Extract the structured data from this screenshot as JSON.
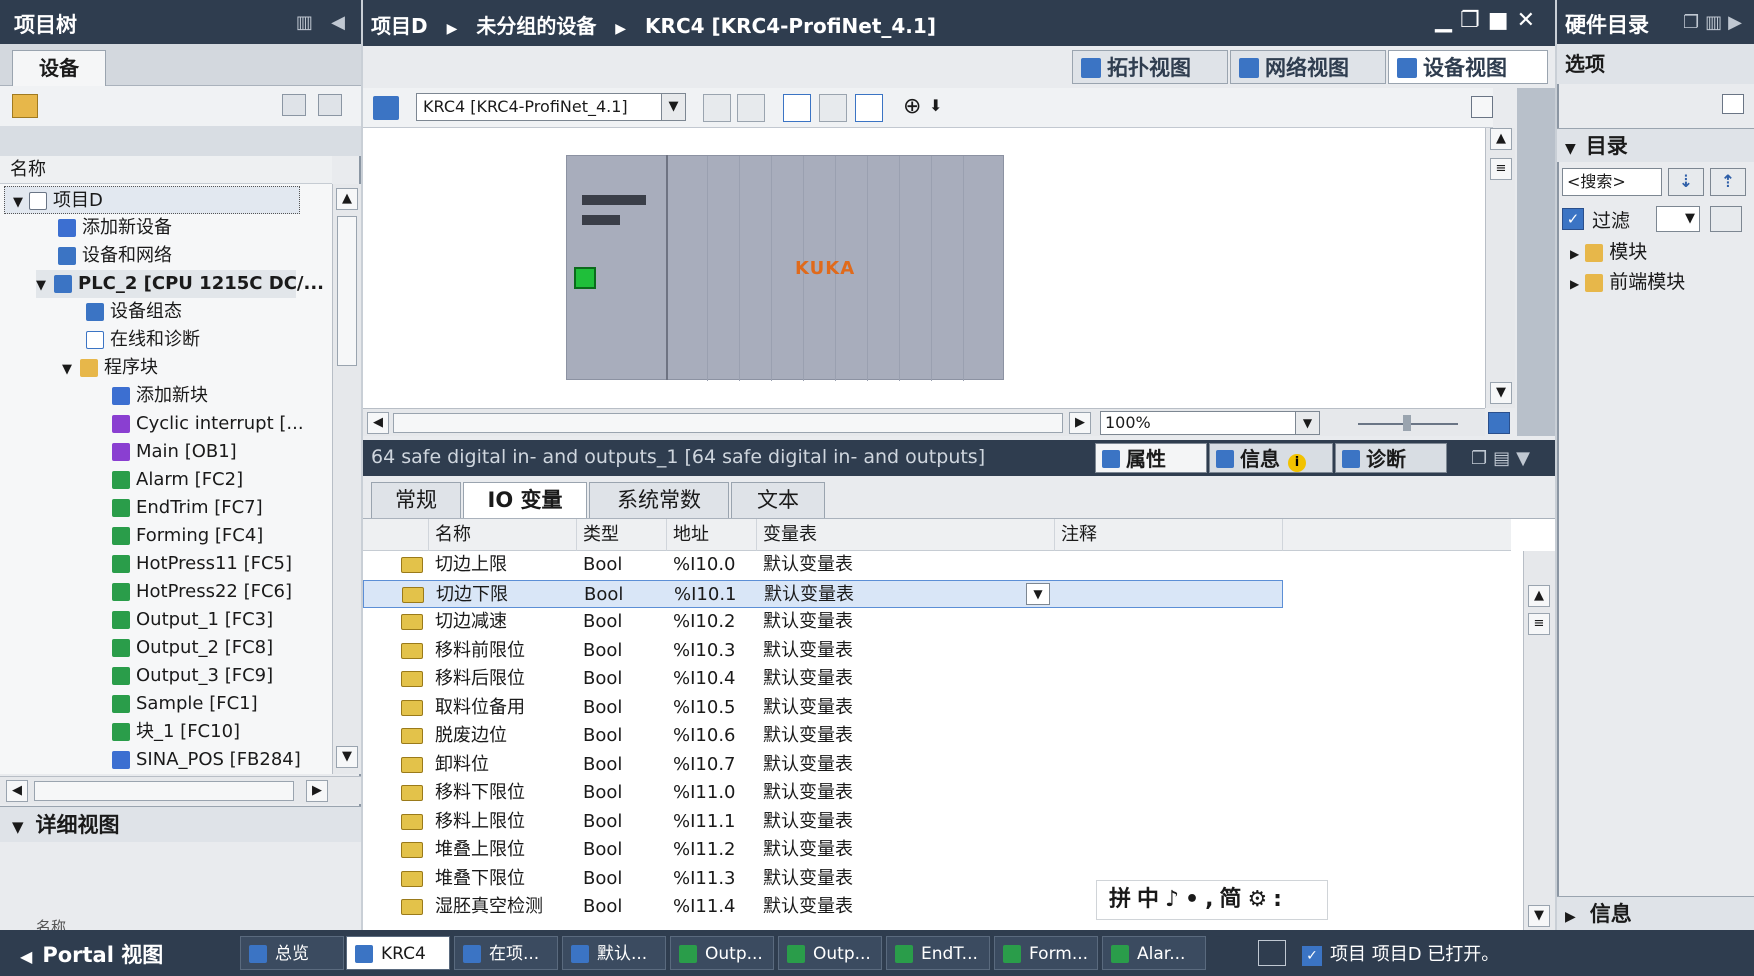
{
  "left_panel": {
    "title": "项目树",
    "tab": "设备",
    "column_header": "名称",
    "tree": [
      {
        "label": "项目D",
        "icon": "project-icon"
      },
      {
        "label": "添加新设备",
        "icon": "add-device-icon"
      },
      {
        "label": "设备和网络",
        "icon": "network-icon"
      },
      {
        "label": "PLC_2 [CPU 1215C DC/...",
        "icon": "plc-icon"
      },
      {
        "label": "设备组态",
        "icon": "device-config-icon"
      },
      {
        "label": "在线和诊断",
        "icon": "online-diag-icon"
      },
      {
        "label": "程序块",
        "icon": "folder-icon"
      },
      {
        "label": "添加新块",
        "icon": "add-block-icon"
      },
      {
        "label": "Cyclic interrupt [...",
        "icon": "ob-icon"
      },
      {
        "label": "Main [OB1]",
        "icon": "ob-icon"
      },
      {
        "label": "Alarm [FC2]",
        "icon": "fc-icon"
      },
      {
        "label": "EndTrim [FC7]",
        "icon": "fc-icon"
      },
      {
        "label": "Forming [FC4]",
        "icon": "fc-icon"
      },
      {
        "label": "HotPress11 [FC5]",
        "icon": "fc-icon"
      },
      {
        "label": "HotPress22 [FC6]",
        "icon": "fc-icon"
      },
      {
        "label": "Output_1 [FC3]",
        "icon": "fc-icon"
      },
      {
        "label": "Output_2 [FC8]",
        "icon": "fc-icon"
      },
      {
        "label": "Output_3 [FC9]",
        "icon": "fc-icon"
      },
      {
        "label": "Sample [FC1]",
        "icon": "fc-icon"
      },
      {
        "label": "块_1 [FC10]",
        "icon": "fc-icon"
      },
      {
        "label": "SINA_POS [FB284]",
        "icon": "fb-icon"
      }
    ],
    "detail_view": "详细视图",
    "detail_col": "名称"
  },
  "breadcrumb": {
    "items": [
      "项目D",
      "未分组的设备",
      "KRC4 [KRC4-ProfiNet_4.1]"
    ]
  },
  "view_tabs": {
    "topology": "拓扑视图",
    "network": "网络视图",
    "device": "设备视图"
  },
  "device_toolbar": {
    "device_select": "KRC4 [KRC4-ProfiNet_4.1]",
    "zoom": "100%"
  },
  "device": {
    "logo": "KUKA"
  },
  "inspector": {
    "title": "64 safe digital in- and outputs_1 [64 safe digital in- and outputs]",
    "tabs": {
      "properties": "属性",
      "info": "信息",
      "diagnostics": "诊断"
    },
    "subtabs": [
      "常规",
      "IO 变量",
      "系统常数",
      "文本"
    ],
    "columns": [
      "名称",
      "类型",
      "地址",
      "变量表",
      "注释"
    ],
    "rows": [
      {
        "name": "切边上限",
        "type": "Bool",
        "address": "%I10.0",
        "table": "默认变量表"
      },
      {
        "name": "切边下限",
        "type": "Bool",
        "address": "%I10.1",
        "table": "默认变量表"
      },
      {
        "name": "切边减速",
        "type": "Bool",
        "address": "%I10.2",
        "table": "默认变量表"
      },
      {
        "name": "移料前限位",
        "type": "Bool",
        "address": "%I10.3",
        "table": "默认变量表"
      },
      {
        "name": "移料后限位",
        "type": "Bool",
        "address": "%I10.4",
        "table": "默认变量表"
      },
      {
        "name": "取料位备用",
        "type": "Bool",
        "address": "%I10.5",
        "table": "默认变量表"
      },
      {
        "name": "脱废边位",
        "type": "Bool",
        "address": "%I10.6",
        "table": "默认变量表"
      },
      {
        "name": "卸料位",
        "type": "Bool",
        "address": "%I10.7",
        "table": "默认变量表"
      },
      {
        "name": "移料下限位",
        "type": "Bool",
        "address": "%I11.0",
        "table": "默认变量表"
      },
      {
        "name": "移料上限位",
        "type": "Bool",
        "address": "%I11.1",
        "table": "默认变量表"
      },
      {
        "name": "堆叠上限位",
        "type": "Bool",
        "address": "%I11.2",
        "table": "默认变量表"
      },
      {
        "name": "堆叠下限位",
        "type": "Bool",
        "address": "%I11.3",
        "table": "默认变量表"
      },
      {
        "name": "湿胚真空检测",
        "type": "Bool",
        "address": "%I11.4",
        "table": "默认变量表"
      }
    ]
  },
  "right_panel": {
    "title": "硬件目录",
    "options": "选项",
    "catalog": "目录",
    "search_placeholder": "<搜索>",
    "filter": "过滤",
    "tree": [
      "模块",
      "前端模块"
    ],
    "info": "信息"
  },
  "ime": "拼中♪•,简⚙:",
  "statusbar": {
    "portal": "Portal 视图",
    "tasks": [
      "总览",
      "KRC4",
      "在项...",
      "默认...",
      "Outp...",
      "Outp...",
      "EndT...",
      "Form...",
      "Alar..."
    ],
    "message": "项目 项目D 已打开。"
  },
  "colors": {
    "chrome": "#2f3d4f",
    "accent": "#3b74c4",
    "kuka": "#e06a1b",
    "selected_row": "#d9e6f7"
  }
}
